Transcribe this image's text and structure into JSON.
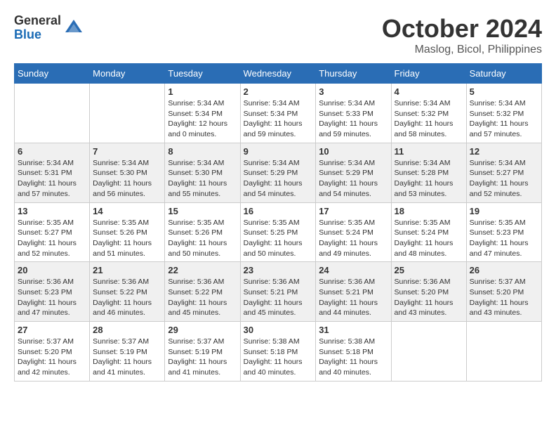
{
  "logo": {
    "general": "General",
    "blue": "Blue"
  },
  "title": "October 2024",
  "location": "Maslog, Bicol, Philippines",
  "weekdays": [
    "Sunday",
    "Monday",
    "Tuesday",
    "Wednesday",
    "Thursday",
    "Friday",
    "Saturday"
  ],
  "weeks": [
    [
      {
        "day": null,
        "sunrise": "",
        "sunset": "",
        "daylight": ""
      },
      {
        "day": null,
        "sunrise": "",
        "sunset": "",
        "daylight": ""
      },
      {
        "day": 1,
        "sunrise": "Sunrise: 5:34 AM",
        "sunset": "Sunset: 5:34 PM",
        "daylight": "Daylight: 12 hours and 0 minutes."
      },
      {
        "day": 2,
        "sunrise": "Sunrise: 5:34 AM",
        "sunset": "Sunset: 5:34 PM",
        "daylight": "Daylight: 11 hours and 59 minutes."
      },
      {
        "day": 3,
        "sunrise": "Sunrise: 5:34 AM",
        "sunset": "Sunset: 5:33 PM",
        "daylight": "Daylight: 11 hours and 59 minutes."
      },
      {
        "day": 4,
        "sunrise": "Sunrise: 5:34 AM",
        "sunset": "Sunset: 5:32 PM",
        "daylight": "Daylight: 11 hours and 58 minutes."
      },
      {
        "day": 5,
        "sunrise": "Sunrise: 5:34 AM",
        "sunset": "Sunset: 5:32 PM",
        "daylight": "Daylight: 11 hours and 57 minutes."
      }
    ],
    [
      {
        "day": 6,
        "sunrise": "Sunrise: 5:34 AM",
        "sunset": "Sunset: 5:31 PM",
        "daylight": "Daylight: 11 hours and 57 minutes."
      },
      {
        "day": 7,
        "sunrise": "Sunrise: 5:34 AM",
        "sunset": "Sunset: 5:30 PM",
        "daylight": "Daylight: 11 hours and 56 minutes."
      },
      {
        "day": 8,
        "sunrise": "Sunrise: 5:34 AM",
        "sunset": "Sunset: 5:30 PM",
        "daylight": "Daylight: 11 hours and 55 minutes."
      },
      {
        "day": 9,
        "sunrise": "Sunrise: 5:34 AM",
        "sunset": "Sunset: 5:29 PM",
        "daylight": "Daylight: 11 hours and 54 minutes."
      },
      {
        "day": 10,
        "sunrise": "Sunrise: 5:34 AM",
        "sunset": "Sunset: 5:29 PM",
        "daylight": "Daylight: 11 hours and 54 minutes."
      },
      {
        "day": 11,
        "sunrise": "Sunrise: 5:34 AM",
        "sunset": "Sunset: 5:28 PM",
        "daylight": "Daylight: 11 hours and 53 minutes."
      },
      {
        "day": 12,
        "sunrise": "Sunrise: 5:34 AM",
        "sunset": "Sunset: 5:27 PM",
        "daylight": "Daylight: 11 hours and 52 minutes."
      }
    ],
    [
      {
        "day": 13,
        "sunrise": "Sunrise: 5:35 AM",
        "sunset": "Sunset: 5:27 PM",
        "daylight": "Daylight: 11 hours and 52 minutes."
      },
      {
        "day": 14,
        "sunrise": "Sunrise: 5:35 AM",
        "sunset": "Sunset: 5:26 PM",
        "daylight": "Daylight: 11 hours and 51 minutes."
      },
      {
        "day": 15,
        "sunrise": "Sunrise: 5:35 AM",
        "sunset": "Sunset: 5:26 PM",
        "daylight": "Daylight: 11 hours and 50 minutes."
      },
      {
        "day": 16,
        "sunrise": "Sunrise: 5:35 AM",
        "sunset": "Sunset: 5:25 PM",
        "daylight": "Daylight: 11 hours and 50 minutes."
      },
      {
        "day": 17,
        "sunrise": "Sunrise: 5:35 AM",
        "sunset": "Sunset: 5:24 PM",
        "daylight": "Daylight: 11 hours and 49 minutes."
      },
      {
        "day": 18,
        "sunrise": "Sunrise: 5:35 AM",
        "sunset": "Sunset: 5:24 PM",
        "daylight": "Daylight: 11 hours and 48 minutes."
      },
      {
        "day": 19,
        "sunrise": "Sunrise: 5:35 AM",
        "sunset": "Sunset: 5:23 PM",
        "daylight": "Daylight: 11 hours and 47 minutes."
      }
    ],
    [
      {
        "day": 20,
        "sunrise": "Sunrise: 5:36 AM",
        "sunset": "Sunset: 5:23 PM",
        "daylight": "Daylight: 11 hours and 47 minutes."
      },
      {
        "day": 21,
        "sunrise": "Sunrise: 5:36 AM",
        "sunset": "Sunset: 5:22 PM",
        "daylight": "Daylight: 11 hours and 46 minutes."
      },
      {
        "day": 22,
        "sunrise": "Sunrise: 5:36 AM",
        "sunset": "Sunset: 5:22 PM",
        "daylight": "Daylight: 11 hours and 45 minutes."
      },
      {
        "day": 23,
        "sunrise": "Sunrise: 5:36 AM",
        "sunset": "Sunset: 5:21 PM",
        "daylight": "Daylight: 11 hours and 45 minutes."
      },
      {
        "day": 24,
        "sunrise": "Sunrise: 5:36 AM",
        "sunset": "Sunset: 5:21 PM",
        "daylight": "Daylight: 11 hours and 44 minutes."
      },
      {
        "day": 25,
        "sunrise": "Sunrise: 5:36 AM",
        "sunset": "Sunset: 5:20 PM",
        "daylight": "Daylight: 11 hours and 43 minutes."
      },
      {
        "day": 26,
        "sunrise": "Sunrise: 5:37 AM",
        "sunset": "Sunset: 5:20 PM",
        "daylight": "Daylight: 11 hours and 43 minutes."
      }
    ],
    [
      {
        "day": 27,
        "sunrise": "Sunrise: 5:37 AM",
        "sunset": "Sunset: 5:20 PM",
        "daylight": "Daylight: 11 hours and 42 minutes."
      },
      {
        "day": 28,
        "sunrise": "Sunrise: 5:37 AM",
        "sunset": "Sunset: 5:19 PM",
        "daylight": "Daylight: 11 hours and 41 minutes."
      },
      {
        "day": 29,
        "sunrise": "Sunrise: 5:37 AM",
        "sunset": "Sunset: 5:19 PM",
        "daylight": "Daylight: 11 hours and 41 minutes."
      },
      {
        "day": 30,
        "sunrise": "Sunrise: 5:38 AM",
        "sunset": "Sunset: 5:18 PM",
        "daylight": "Daylight: 11 hours and 40 minutes."
      },
      {
        "day": 31,
        "sunrise": "Sunrise: 5:38 AM",
        "sunset": "Sunset: 5:18 PM",
        "daylight": "Daylight: 11 hours and 40 minutes."
      },
      {
        "day": null,
        "sunrise": "",
        "sunset": "",
        "daylight": ""
      },
      {
        "day": null,
        "sunrise": "",
        "sunset": "",
        "daylight": ""
      }
    ]
  ]
}
